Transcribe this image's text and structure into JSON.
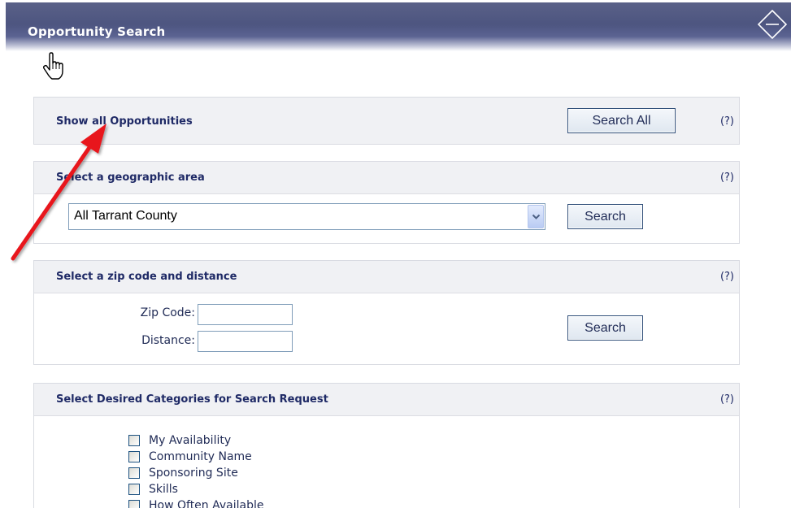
{
  "header": {
    "title": "Opportunity Search"
  },
  "show_all": {
    "title": "Show all Opportunities",
    "button_label": "Search All",
    "help": "(?)"
  },
  "geo": {
    "title": "Select a geographic area",
    "help": "(?)",
    "selected": "All Tarrant County",
    "button_label": "Search"
  },
  "zip": {
    "title": "Select a zip code and distance",
    "help": "(?)",
    "zip_label": "Zip Code:",
    "zip_value": "",
    "distance_label": "Distance:",
    "distance_value": "",
    "button_label": "Search"
  },
  "categories": {
    "title": "Select Desired Categories for Search Request",
    "help": "(?)",
    "items": [
      {
        "label": "My Availability",
        "checked": false
      },
      {
        "label": "Community Name",
        "checked": false
      },
      {
        "label": "Sponsoring Site",
        "checked": false
      },
      {
        "label": "Skills",
        "checked": false
      },
      {
        "label": "How Often Available",
        "checked": false
      }
    ]
  },
  "colors": {
    "header_bg": "#4d5580",
    "section_head_bg": "#f0f1f4",
    "title_text": "#1f2a66",
    "annotation_arrow": "#e8161c"
  },
  "icons": {
    "collapse": "collapse-diamond-icon",
    "pointer": "hand-pointer-icon",
    "dropdown": "chevron-down-icon"
  }
}
